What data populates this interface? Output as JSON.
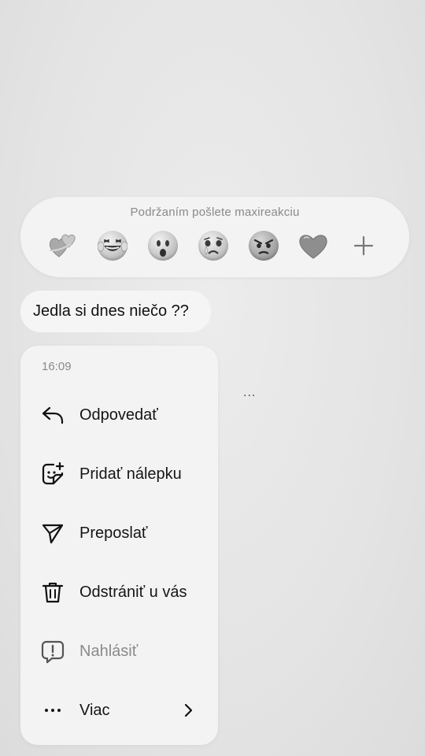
{
  "reactions": {
    "hint": "Podržaním pošlete maxireakciu",
    "emojis": [
      "hearts-emoji",
      "laughing-tears-emoji",
      "surprised-emoji",
      "crying-emoji",
      "angry-emoji",
      "heart-emoji",
      "plus-icon"
    ]
  },
  "message": {
    "text": "Jedla si dnes niečo ??"
  },
  "typing": {
    "text": "..."
  },
  "menu": {
    "time": "16:09",
    "items": [
      {
        "label": "Odpovedať",
        "icon": "reply-icon"
      },
      {
        "label": "Pridať nálepku",
        "icon": "sticker-icon"
      },
      {
        "label": "Preposlať",
        "icon": "forward-icon"
      },
      {
        "label": "Odstrániť u vás",
        "icon": "trash-icon"
      },
      {
        "label": "Nahlásiť",
        "icon": "report-icon"
      },
      {
        "label": "Viac",
        "icon": "more-icon"
      }
    ]
  }
}
